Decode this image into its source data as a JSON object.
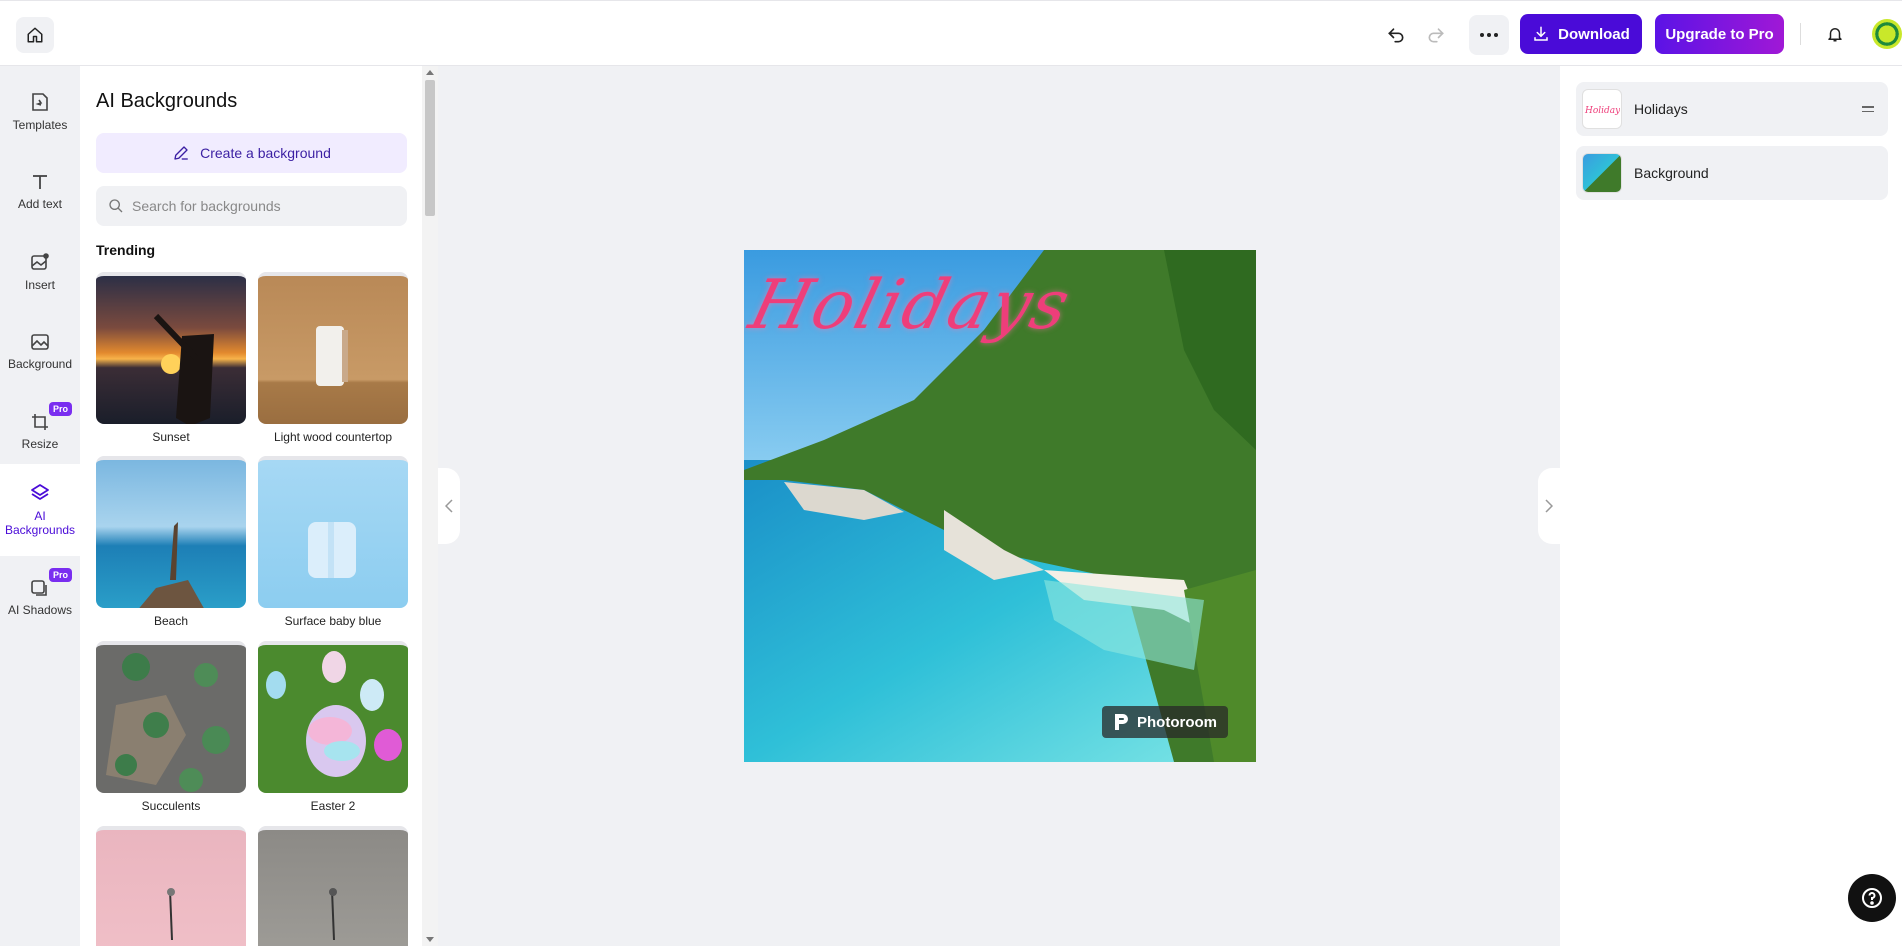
{
  "topbar": {
    "download_label": "Download",
    "upgrade_label": "Upgrade to Pro"
  },
  "rail": {
    "items": [
      {
        "label": "Templates",
        "icon": "templates-icon"
      },
      {
        "label": "Add text",
        "icon": "text-icon"
      },
      {
        "label": "Insert",
        "icon": "insert-image-icon"
      },
      {
        "label": "Background",
        "icon": "background-icon"
      },
      {
        "label": "Resize",
        "icon": "crop-icon",
        "badge": "Pro"
      },
      {
        "label": "AI Backgrounds",
        "icon": "layers-icon",
        "active": true
      },
      {
        "label": "AI Shadows",
        "icon": "shadow-icon",
        "badge": "Pro"
      }
    ]
  },
  "panel": {
    "title": "AI Backgrounds",
    "create_label": "Create a background",
    "search_placeholder": "Search for backgrounds",
    "section_title": "Trending",
    "cards": [
      {
        "label": "Sunset"
      },
      {
        "label": "Light wood countertop"
      },
      {
        "label": "Beach"
      },
      {
        "label": "Surface baby blue"
      },
      {
        "label": "Succulents"
      },
      {
        "label": "Easter 2"
      },
      {
        "label": ""
      },
      {
        "label": ""
      }
    ]
  },
  "canvas": {
    "title_text": "Holidays",
    "watermark": "Photoroom"
  },
  "layers": {
    "items": [
      {
        "label": "Holidays"
      },
      {
        "label": "Background"
      }
    ]
  },
  "colors": {
    "accent": "#4a0bd8",
    "upgrade_gradient_start": "#5b13e6",
    "upgrade_gradient_end": "#a018d6",
    "pro_badge": "#7a2ef0",
    "title_pink": "#ee3e7a"
  }
}
